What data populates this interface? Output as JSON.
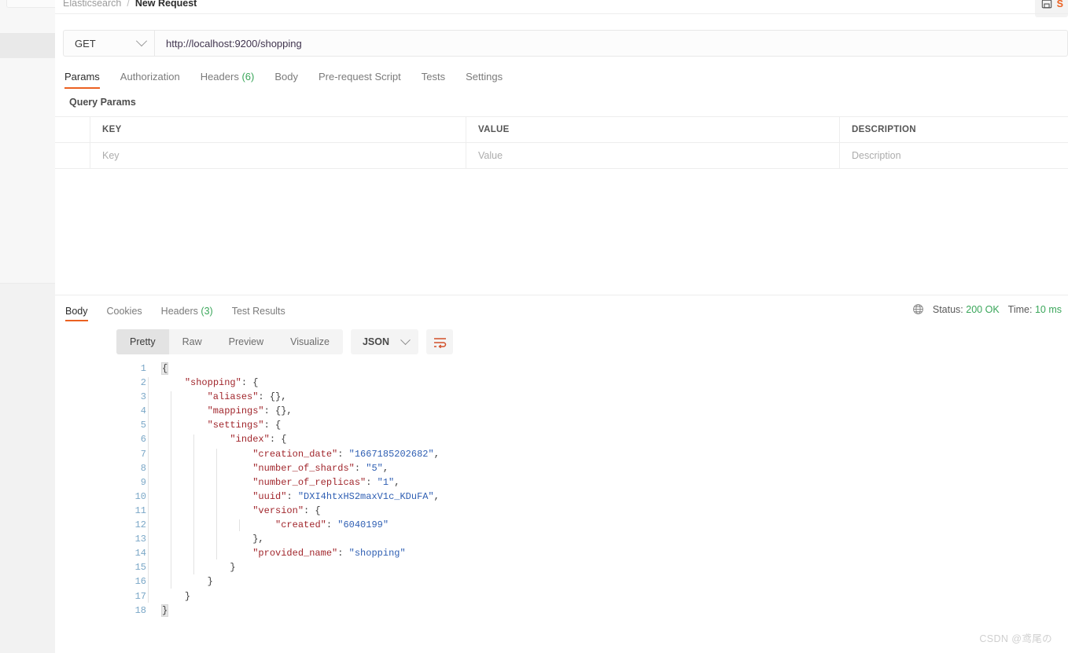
{
  "breadcrumb": {
    "collection": "Elasticsearch",
    "separator": "/",
    "current": "New Request"
  },
  "toolbar": {
    "save_label": "S",
    "save_icon": "save-icon"
  },
  "request": {
    "method": "GET",
    "url": "http://localhost:9200/shopping",
    "tabs": [
      {
        "label": "Params",
        "active": true
      },
      {
        "label": "Authorization",
        "active": false
      },
      {
        "label": "Headers",
        "count": "(6)",
        "active": false
      },
      {
        "label": "Body",
        "active": false
      },
      {
        "label": "Pre-request Script",
        "active": false
      },
      {
        "label": "Tests",
        "active": false
      },
      {
        "label": "Settings",
        "active": false
      }
    ]
  },
  "query_params": {
    "section_title": "Query Params",
    "headers": {
      "key": "KEY",
      "value": "VALUE",
      "description": "DESCRIPTION"
    },
    "row": {
      "key": "Key",
      "value": "Value",
      "description": "Description"
    }
  },
  "response": {
    "tabs": [
      {
        "label": "Body",
        "active": true
      },
      {
        "label": "Cookies",
        "active": false
      },
      {
        "label": "Headers",
        "count": "(3)",
        "active": false
      },
      {
        "label": "Test Results",
        "active": false
      }
    ],
    "status_label": "Status:",
    "status_value": "200 OK",
    "time_label": "Time:",
    "time_value": "10 ms",
    "globe_icon": "globe-icon",
    "views": [
      {
        "label": "Pretty",
        "active": true
      },
      {
        "label": "Raw",
        "active": false
      },
      {
        "label": "Preview",
        "active": false
      },
      {
        "label": "Visualize",
        "active": false
      }
    ],
    "format": "JSON",
    "wrap_icon": "wrap-lines-icon"
  },
  "code": {
    "lines": [
      {
        "n": "1",
        "indent": 0,
        "parts": [
          {
            "t": "{",
            "c": "brace hl"
          }
        ]
      },
      {
        "n": "2",
        "indent": 1,
        "parts": [
          {
            "t": "\"shopping\"",
            "c": "key"
          },
          {
            "t": ": {",
            "c": "punc"
          }
        ]
      },
      {
        "n": "3",
        "indent": 2,
        "parts": [
          {
            "t": "\"aliases\"",
            "c": "key"
          },
          {
            "t": ": {},",
            "c": "punc"
          }
        ]
      },
      {
        "n": "4",
        "indent": 2,
        "parts": [
          {
            "t": "\"mappings\"",
            "c": "key"
          },
          {
            "t": ": {},",
            "c": "punc"
          }
        ]
      },
      {
        "n": "5",
        "indent": 2,
        "parts": [
          {
            "t": "\"settings\"",
            "c": "key"
          },
          {
            "t": ": {",
            "c": "punc"
          }
        ]
      },
      {
        "n": "6",
        "indent": 3,
        "parts": [
          {
            "t": "\"index\"",
            "c": "key"
          },
          {
            "t": ": {",
            "c": "punc"
          }
        ]
      },
      {
        "n": "7",
        "indent": 4,
        "parts": [
          {
            "t": "\"creation_date\"",
            "c": "key"
          },
          {
            "t": ": ",
            "c": "punc"
          },
          {
            "t": "\"1667185202682\"",
            "c": "str"
          },
          {
            "t": ",",
            "c": "punc"
          }
        ]
      },
      {
        "n": "8",
        "indent": 4,
        "parts": [
          {
            "t": "\"number_of_shards\"",
            "c": "key"
          },
          {
            "t": ": ",
            "c": "punc"
          },
          {
            "t": "\"5\"",
            "c": "str"
          },
          {
            "t": ",",
            "c": "punc"
          }
        ]
      },
      {
        "n": "9",
        "indent": 4,
        "parts": [
          {
            "t": "\"number_of_replicas\"",
            "c": "key"
          },
          {
            "t": ": ",
            "c": "punc"
          },
          {
            "t": "\"1\"",
            "c": "str"
          },
          {
            "t": ",",
            "c": "punc"
          }
        ]
      },
      {
        "n": "10",
        "indent": 4,
        "parts": [
          {
            "t": "\"uuid\"",
            "c": "key"
          },
          {
            "t": ": ",
            "c": "punc"
          },
          {
            "t": "\"DXI4htxHS2maxV1c_KDuFA\"",
            "c": "str"
          },
          {
            "t": ",",
            "c": "punc"
          }
        ]
      },
      {
        "n": "11",
        "indent": 4,
        "parts": [
          {
            "t": "\"version\"",
            "c": "key"
          },
          {
            "t": ": {",
            "c": "punc"
          }
        ]
      },
      {
        "n": "12",
        "indent": 5,
        "parts": [
          {
            "t": "\"created\"",
            "c": "key"
          },
          {
            "t": ": ",
            "c": "punc"
          },
          {
            "t": "\"6040199\"",
            "c": "str"
          }
        ]
      },
      {
        "n": "13",
        "indent": 4,
        "parts": [
          {
            "t": "},",
            "c": "punc"
          }
        ]
      },
      {
        "n": "14",
        "indent": 4,
        "parts": [
          {
            "t": "\"provided_name\"",
            "c": "key"
          },
          {
            "t": ": ",
            "c": "punc"
          },
          {
            "t": "\"shopping\"",
            "c": "str"
          }
        ]
      },
      {
        "n": "15",
        "indent": 3,
        "parts": [
          {
            "t": "}",
            "c": "punc"
          }
        ]
      },
      {
        "n": "16",
        "indent": 2,
        "parts": [
          {
            "t": "}",
            "c": "punc"
          }
        ]
      },
      {
        "n": "17",
        "indent": 1,
        "parts": [
          {
            "t": "}",
            "c": "punc"
          }
        ]
      },
      {
        "n": "18",
        "indent": 0,
        "parts": [
          {
            "t": "}",
            "c": "brace hl"
          }
        ]
      }
    ]
  },
  "watermark": "CSDN @鸢尾の",
  "colors": {
    "accent": "#eb6121",
    "success": "#3aa65a",
    "json_key": "#a1262c",
    "json_string": "#2f5fb3",
    "line_number": "#7aa7c7"
  }
}
